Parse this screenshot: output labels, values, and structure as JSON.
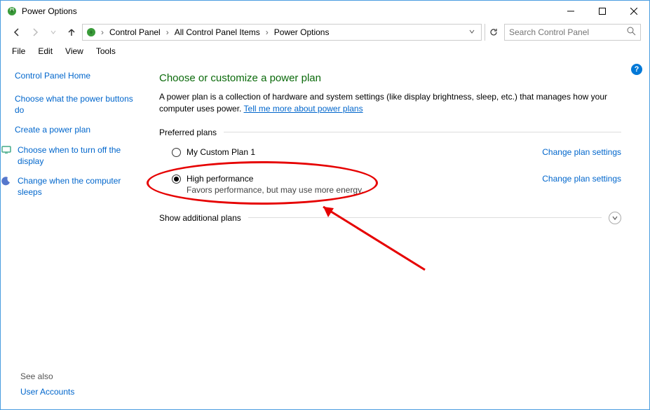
{
  "window": {
    "title": "Power Options"
  },
  "breadcrumb": {
    "segments": [
      "Control Panel",
      "All Control Panel Items",
      "Power Options"
    ]
  },
  "search": {
    "placeholder": "Search Control Panel"
  },
  "menubar": [
    "File",
    "Edit",
    "View",
    "Tools"
  ],
  "sidebar": {
    "home": "Control Panel Home",
    "links": [
      {
        "label": "Choose what the power buttons do",
        "icon": null
      },
      {
        "label": "Create a power plan",
        "icon": null
      },
      {
        "label": "Choose when to turn off the display",
        "icon": "monitor"
      },
      {
        "label": "Change when the computer sleeps",
        "icon": "moon"
      }
    ],
    "seealso_label": "See also",
    "seealso_link": "User Accounts"
  },
  "main": {
    "heading": "Choose or customize a power plan",
    "desc_text": "A power plan is a collection of hardware and system settings (like display brightness, sleep, etc.) that manages how your computer uses power. ",
    "desc_link": "Tell me more about power plans",
    "preferred_label": "Preferred plans",
    "plans": [
      {
        "name": "My Custom Plan 1",
        "desc": "",
        "selected": false,
        "settings_label": "Change plan settings"
      },
      {
        "name": "High performance",
        "desc": "Favors performance, but may use more energy.",
        "selected": true,
        "settings_label": "Change plan settings"
      }
    ],
    "show_more_label": "Show additional plans"
  }
}
